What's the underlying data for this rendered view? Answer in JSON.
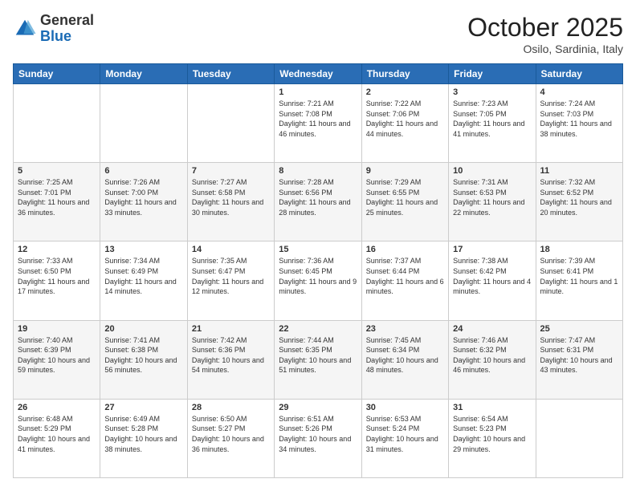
{
  "logo": {
    "general": "General",
    "blue": "Blue"
  },
  "header": {
    "month": "October 2025",
    "location": "Osilo, Sardinia, Italy"
  },
  "days_of_week": [
    "Sunday",
    "Monday",
    "Tuesday",
    "Wednesday",
    "Thursday",
    "Friday",
    "Saturday"
  ],
  "weeks": [
    [
      {
        "day": "",
        "info": ""
      },
      {
        "day": "",
        "info": ""
      },
      {
        "day": "",
        "info": ""
      },
      {
        "day": "1",
        "info": "Sunrise: 7:21 AM\nSunset: 7:08 PM\nDaylight: 11 hours and 46 minutes."
      },
      {
        "day": "2",
        "info": "Sunrise: 7:22 AM\nSunset: 7:06 PM\nDaylight: 11 hours and 44 minutes."
      },
      {
        "day": "3",
        "info": "Sunrise: 7:23 AM\nSunset: 7:05 PM\nDaylight: 11 hours and 41 minutes."
      },
      {
        "day": "4",
        "info": "Sunrise: 7:24 AM\nSunset: 7:03 PM\nDaylight: 11 hours and 38 minutes."
      }
    ],
    [
      {
        "day": "5",
        "info": "Sunrise: 7:25 AM\nSunset: 7:01 PM\nDaylight: 11 hours and 36 minutes."
      },
      {
        "day": "6",
        "info": "Sunrise: 7:26 AM\nSunset: 7:00 PM\nDaylight: 11 hours and 33 minutes."
      },
      {
        "day": "7",
        "info": "Sunrise: 7:27 AM\nSunset: 6:58 PM\nDaylight: 11 hours and 30 minutes."
      },
      {
        "day": "8",
        "info": "Sunrise: 7:28 AM\nSunset: 6:56 PM\nDaylight: 11 hours and 28 minutes."
      },
      {
        "day": "9",
        "info": "Sunrise: 7:29 AM\nSunset: 6:55 PM\nDaylight: 11 hours and 25 minutes."
      },
      {
        "day": "10",
        "info": "Sunrise: 7:31 AM\nSunset: 6:53 PM\nDaylight: 11 hours and 22 minutes."
      },
      {
        "day": "11",
        "info": "Sunrise: 7:32 AM\nSunset: 6:52 PM\nDaylight: 11 hours and 20 minutes."
      }
    ],
    [
      {
        "day": "12",
        "info": "Sunrise: 7:33 AM\nSunset: 6:50 PM\nDaylight: 11 hours and 17 minutes."
      },
      {
        "day": "13",
        "info": "Sunrise: 7:34 AM\nSunset: 6:49 PM\nDaylight: 11 hours and 14 minutes."
      },
      {
        "day": "14",
        "info": "Sunrise: 7:35 AM\nSunset: 6:47 PM\nDaylight: 11 hours and 12 minutes."
      },
      {
        "day": "15",
        "info": "Sunrise: 7:36 AM\nSunset: 6:45 PM\nDaylight: 11 hours and 9 minutes."
      },
      {
        "day": "16",
        "info": "Sunrise: 7:37 AM\nSunset: 6:44 PM\nDaylight: 11 hours and 6 minutes."
      },
      {
        "day": "17",
        "info": "Sunrise: 7:38 AM\nSunset: 6:42 PM\nDaylight: 11 hours and 4 minutes."
      },
      {
        "day": "18",
        "info": "Sunrise: 7:39 AM\nSunset: 6:41 PM\nDaylight: 11 hours and 1 minute."
      }
    ],
    [
      {
        "day": "19",
        "info": "Sunrise: 7:40 AM\nSunset: 6:39 PM\nDaylight: 10 hours and 59 minutes."
      },
      {
        "day": "20",
        "info": "Sunrise: 7:41 AM\nSunset: 6:38 PM\nDaylight: 10 hours and 56 minutes."
      },
      {
        "day": "21",
        "info": "Sunrise: 7:42 AM\nSunset: 6:36 PM\nDaylight: 10 hours and 54 minutes."
      },
      {
        "day": "22",
        "info": "Sunrise: 7:44 AM\nSunset: 6:35 PM\nDaylight: 10 hours and 51 minutes."
      },
      {
        "day": "23",
        "info": "Sunrise: 7:45 AM\nSunset: 6:34 PM\nDaylight: 10 hours and 48 minutes."
      },
      {
        "day": "24",
        "info": "Sunrise: 7:46 AM\nSunset: 6:32 PM\nDaylight: 10 hours and 46 minutes."
      },
      {
        "day": "25",
        "info": "Sunrise: 7:47 AM\nSunset: 6:31 PM\nDaylight: 10 hours and 43 minutes."
      }
    ],
    [
      {
        "day": "26",
        "info": "Sunrise: 6:48 AM\nSunset: 5:29 PM\nDaylight: 10 hours and 41 minutes."
      },
      {
        "day": "27",
        "info": "Sunrise: 6:49 AM\nSunset: 5:28 PM\nDaylight: 10 hours and 38 minutes."
      },
      {
        "day": "28",
        "info": "Sunrise: 6:50 AM\nSunset: 5:27 PM\nDaylight: 10 hours and 36 minutes."
      },
      {
        "day": "29",
        "info": "Sunrise: 6:51 AM\nSunset: 5:26 PM\nDaylight: 10 hours and 34 minutes."
      },
      {
        "day": "30",
        "info": "Sunrise: 6:53 AM\nSunset: 5:24 PM\nDaylight: 10 hours and 31 minutes."
      },
      {
        "day": "31",
        "info": "Sunrise: 6:54 AM\nSunset: 5:23 PM\nDaylight: 10 hours and 29 minutes."
      },
      {
        "day": "",
        "info": ""
      }
    ]
  ]
}
